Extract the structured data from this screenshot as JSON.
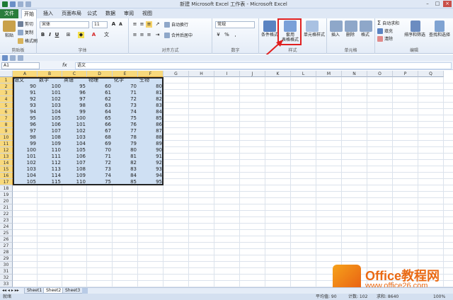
{
  "window": {
    "title": "新建 Microsoft Excel 工作表 - Microsoft Excel",
    "controls": [
      "minimize-icon",
      "maximize-icon",
      "close-icon"
    ]
  },
  "tabs": [
    {
      "label": "文件"
    },
    {
      "label": "开始"
    },
    {
      "label": "插入"
    },
    {
      "label": "页面布局"
    },
    {
      "label": "公式"
    },
    {
      "label": "数据"
    },
    {
      "label": "审阅"
    },
    {
      "label": "视图"
    }
  ],
  "ribbon": {
    "clipboard": {
      "group": "剪贴板",
      "paste": "粘贴",
      "cut": "剪切",
      "copy": "复制",
      "format_painter": "格式刷"
    },
    "font": {
      "group": "字体",
      "name": "宋体",
      "size": "11",
      "bold": "B",
      "italic": "I",
      "underline": "U",
      "font_color_glyph": "A"
    },
    "alignment": {
      "group": "对齐方式",
      "wrap": "自动换行",
      "merge": "合并后居中"
    },
    "number": {
      "group": "数字",
      "format": "常规",
      "percent": "%",
      "comma": ","
    },
    "styles": {
      "group": "样式",
      "conditional": "条件格式",
      "table_format_line1": "套用",
      "table_format_line2": "表格格式",
      "cell_styles": "单元格样式"
    },
    "cells": {
      "group": "单元格",
      "insert": "插入",
      "delete": "删除",
      "format": "格式"
    },
    "editing": {
      "group": "编辑",
      "autosum": "自动求和",
      "fill": "填充",
      "clear": "清除",
      "sort": "排序和筛选",
      "find": "查找和选择"
    }
  },
  "formula_bar": {
    "name_box": "A1",
    "fx": "fx",
    "content": "语文"
  },
  "sheet": {
    "columns": [
      "A",
      "B",
      "C",
      "D",
      "E",
      "F",
      "G",
      "H",
      "I",
      "J",
      "K",
      "L",
      "M",
      "N",
      "O",
      "P",
      "Q"
    ],
    "headers": [
      "语文",
      "数学",
      "英语",
      "物理",
      "化学",
      "生物"
    ],
    "rows": [
      [
        90,
        100,
        95,
        60,
        70,
        80
      ],
      [
        91,
        101,
        96,
        61,
        71,
        81
      ],
      [
        92,
        102,
        97,
        62,
        72,
        82
      ],
      [
        93,
        103,
        98,
        63,
        73,
        83
      ],
      [
        94,
        104,
        99,
        64,
        74,
        84
      ],
      [
        95,
        105,
        100,
        65,
        75,
        85
      ],
      [
        96,
        106,
        101,
        66,
        76,
        86
      ],
      [
        97,
        107,
        102,
        67,
        77,
        87
      ],
      [
        98,
        108,
        103,
        68,
        78,
        88
      ],
      [
        99,
        109,
        104,
        69,
        79,
        89
      ],
      [
        100,
        110,
        105,
        70,
        80,
        90
      ],
      [
        101,
        111,
        106,
        71,
        81,
        91
      ],
      [
        102,
        112,
        107,
        72,
        82,
        92
      ],
      [
        103,
        113,
        108,
        73,
        83,
        93
      ],
      [
        104,
        114,
        109,
        74,
        84,
        94
      ],
      [
        105,
        115,
        110,
        75,
        85,
        95
      ]
    ],
    "row_numbers": [
      "1",
      "2",
      "3",
      "4",
      "5",
      "6",
      "7",
      "8",
      "9",
      "10",
      "11",
      "12",
      "13",
      "14",
      "15",
      "16",
      "17",
      "18",
      "19",
      "20",
      "21",
      "22",
      "23",
      "24",
      "25",
      "26",
      "27",
      "28",
      "29",
      "30",
      "31",
      "32",
      "33"
    ]
  },
  "sheet_tabs": [
    "Sheet1",
    "Sheet2",
    "Sheet3"
  ],
  "status": {
    "ready": "就绪",
    "average": "平均值: 90",
    "count": "计数: 102",
    "sum": "求和: 8640",
    "zoom": "100%"
  },
  "watermark": {
    "brand": "Office教程网",
    "url": "www.office26.com"
  },
  "colors": {
    "selection": "#cfe0f3",
    "header_selected": "#f8d97c",
    "file_tab": "#2a7d3c",
    "annotation": "#e02020"
  }
}
